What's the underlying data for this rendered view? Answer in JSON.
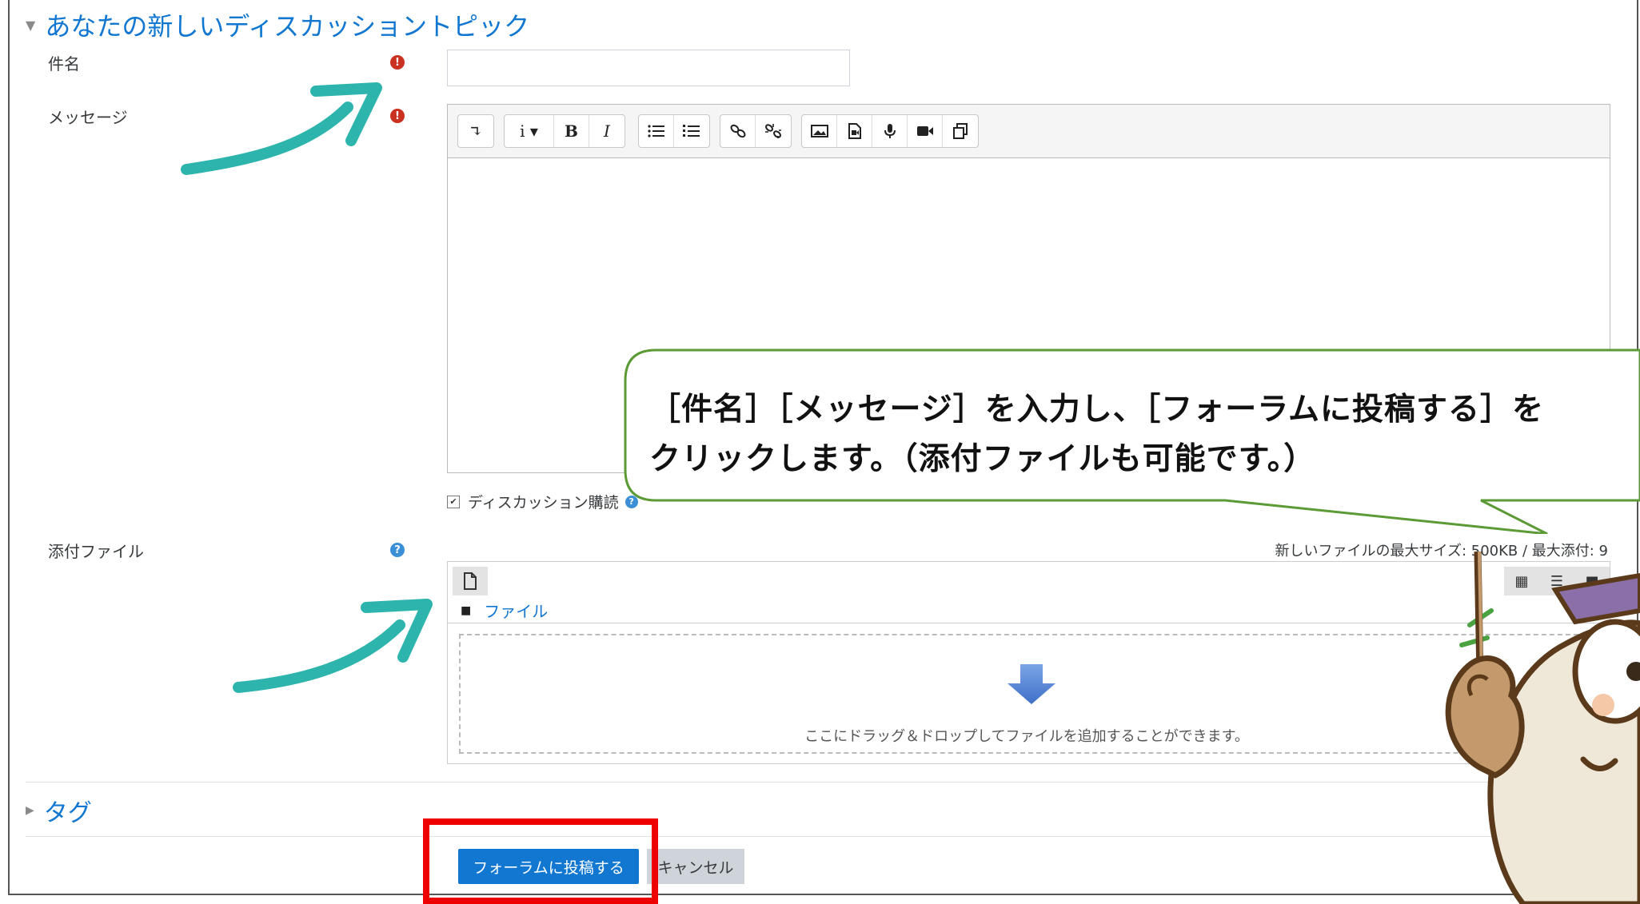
{
  "form": {
    "section_title": "あなたの新しいディスカッショントピック",
    "subject_label": "件名",
    "message_label": "メッセージ",
    "subscribe_label": "ディスカッション購読",
    "subscribe_checked": true,
    "attachment_label": "添付ファイル",
    "max_size_text": "新しいファイルの最大サイズ: 500KB / 最大添付: 9",
    "file_path_label": "ファイル",
    "drop_text": "ここにドラッグ＆ドロップしてファイルを追加することができます。",
    "tags_title": "タグ",
    "submit_label": "フォーラムに投稿する",
    "cancel_label": "キャンセル"
  },
  "toolbar": {
    "collapse": "↴",
    "info": "i ▾",
    "bold": "B",
    "italic": "I"
  },
  "balloon": {
    "line1": "［件名］［メッセージ］を入力し、［フォーラムに投稿する］を",
    "line2": "クリックします。（添付ファイルも可能です。）"
  },
  "colors": {
    "link_blue": "#1177d1",
    "required_red": "#ca3120",
    "arrow_teal": "#2db5ad",
    "balloon_border": "#5b9a35",
    "highlight_red": "#ee0000"
  }
}
